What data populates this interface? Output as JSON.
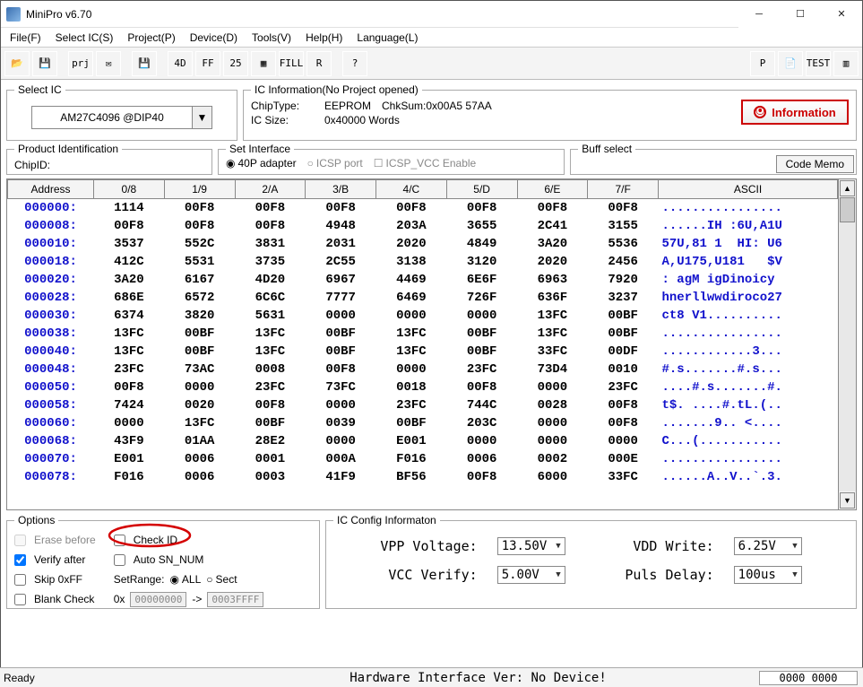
{
  "window": {
    "title": "MiniPro v6.70"
  },
  "menu": {
    "items": [
      "File(F)",
      "Select IC(S)",
      "Project(P)",
      "Device(D)",
      "Tools(V)",
      "Help(H)",
      "Language(L)"
    ]
  },
  "toolbar": {
    "buttons": [
      {
        "name": "open-icon",
        "label": "📂"
      },
      {
        "name": "save-icon",
        "label": "💾"
      },
      {
        "name": "open-project-icon",
        "label": "prj"
      },
      {
        "name": "save-project-icon",
        "label": "✉"
      },
      {
        "name": "disk-icon",
        "label": "💾"
      },
      {
        "name": "search-4d-icon",
        "label": "4D"
      },
      {
        "name": "ff-icon",
        "label": "FF"
      },
      {
        "name": "25-icon",
        "label": "25"
      },
      {
        "name": "box-icon",
        "label": "▦"
      },
      {
        "name": "fill-icon",
        "label": "FILL"
      },
      {
        "name": "r-icon",
        "label": "R"
      },
      {
        "name": "help-icon",
        "label": "?"
      },
      {
        "name": "p-chip-icon",
        "label": "P"
      },
      {
        "name": "sheet-icon",
        "label": "📄"
      },
      {
        "name": "test-icon",
        "label": "TEST"
      },
      {
        "name": "chip-icon",
        "label": "▥"
      }
    ]
  },
  "select_ic": {
    "legend": "Select IC",
    "value": "AM27C4096  @DIP40"
  },
  "ic_info": {
    "legend": "IC Information(No Project opened)",
    "chip_type_label": "ChipType:",
    "chip_type": "EEPROM",
    "chk_sum_label": "ChkSum:0x00A5 57AA",
    "ic_size_label": "IC Size:",
    "ic_size": "0x40000 Words",
    "info_button": "Information"
  },
  "product_id": {
    "legend": "Product Identification",
    "chipid_label": "ChipID:"
  },
  "set_interface": {
    "legend": "Set Interface",
    "option_40p": "40P adapter",
    "option_icsp": "ICSP port",
    "chk_icsp_vcc": "ICSP_VCC Enable"
  },
  "buff_select": {
    "legend": "Buff select",
    "code_memo": "Code Memo"
  },
  "hex": {
    "headers": [
      "Address",
      "0/8",
      "1/9",
      "2/A",
      "3/B",
      "4/C",
      "5/D",
      "6/E",
      "7/F",
      "ASCII"
    ],
    "rows": [
      {
        "addr": "000000:",
        "d": [
          "1114",
          "00F8",
          "00F8",
          "00F8",
          "00F8",
          "00F8",
          "00F8",
          "00F8"
        ],
        "ascii": "................"
      },
      {
        "addr": "000008:",
        "d": [
          "00F8",
          "00F8",
          "00F8",
          "4948",
          "203A",
          "3655",
          "2C41",
          "3155"
        ],
        "ascii": "......IH :6U,A1U"
      },
      {
        "addr": "000010:",
        "d": [
          "3537",
          "552C",
          "3831",
          "2031",
          "2020",
          "4849",
          "3A20",
          "5536"
        ],
        "ascii": "57U,81 1  HI: U6"
      },
      {
        "addr": "000018:",
        "d": [
          "412C",
          "5531",
          "3735",
          "2C55",
          "3138",
          "3120",
          "2020",
          "2456"
        ],
        "ascii": "A,U175,U181   $V"
      },
      {
        "addr": "000020:",
        "d": [
          "3A20",
          "6167",
          "4D20",
          "6967",
          "4469",
          "6E6F",
          "6963",
          "7920"
        ],
        "ascii": ": agM igDinoicy "
      },
      {
        "addr": "000028:",
        "d": [
          "686E",
          "6572",
          "6C6C",
          "7777",
          "6469",
          "726F",
          "636F",
          "3237"
        ],
        "ascii": "hnerllwwdiroco27"
      },
      {
        "addr": "000030:",
        "d": [
          "6374",
          "3820",
          "5631",
          "0000",
          "0000",
          "0000",
          "13FC",
          "00BF"
        ],
        "ascii": "ct8 V1.........."
      },
      {
        "addr": "000038:",
        "d": [
          "13FC",
          "00BF",
          "13FC",
          "00BF",
          "13FC",
          "00BF",
          "13FC",
          "00BF"
        ],
        "ascii": "................"
      },
      {
        "addr": "000040:",
        "d": [
          "13FC",
          "00BF",
          "13FC",
          "00BF",
          "13FC",
          "00BF",
          "33FC",
          "00DF"
        ],
        "ascii": "............3..."
      },
      {
        "addr": "000048:",
        "d": [
          "23FC",
          "73AC",
          "0008",
          "00F8",
          "0000",
          "23FC",
          "73D4",
          "0010"
        ],
        "ascii": "#.s.......#.s..."
      },
      {
        "addr": "000050:",
        "d": [
          "00F8",
          "0000",
          "23FC",
          "73FC",
          "0018",
          "00F8",
          "0000",
          "23FC"
        ],
        "ascii": "....#.s.......#."
      },
      {
        "addr": "000058:",
        "d": [
          "7424",
          "0020",
          "00F8",
          "0000",
          "23FC",
          "744C",
          "0028",
          "00F8"
        ],
        "ascii": "t$. ....#.tL.(.."
      },
      {
        "addr": "000060:",
        "d": [
          "0000",
          "13FC",
          "00BF",
          "0039",
          "00BF",
          "203C",
          "0000",
          "00F8"
        ],
        "ascii": ".......9.. <...."
      },
      {
        "addr": "000068:",
        "d": [
          "43F9",
          "01AA",
          "28E2",
          "0000",
          "E001",
          "0000",
          "0000",
          "0000"
        ],
        "ascii": "C...(..........."
      },
      {
        "addr": "000070:",
        "d": [
          "E001",
          "0006",
          "0001",
          "000A",
          "F016",
          "0006",
          "0002",
          "000E"
        ],
        "ascii": "................"
      },
      {
        "addr": "000078:",
        "d": [
          "F016",
          "0006",
          "0003",
          "41F9",
          "BF56",
          "00F8",
          "6000",
          "33FC"
        ],
        "ascii": "......A..V..`.3."
      }
    ]
  },
  "options": {
    "legend": "Options",
    "erase_before": "Erase before",
    "verify_after": "Verify after",
    "skip_0xff": "Skip 0xFF",
    "blank_check": "Blank Check",
    "check_id": "Check ID",
    "auto_sn": "Auto SN_NUM",
    "setrange": "SetRange:",
    "all": "ALL",
    "sect": "Sect",
    "0x": "0x",
    "from": "00000000",
    "arrow": "->",
    "to": "0003FFFF"
  },
  "ic_config": {
    "legend": "IC Config Informaton",
    "vpp_label": "VPP Voltage:",
    "vpp_value": "13.50V",
    "vdd_label": "VDD Write:",
    "vdd_value": "6.25V",
    "vcc_label": "VCC Verify:",
    "vcc_value": "5.00V",
    "puls_label": "Puls Delay:",
    "puls_value": "100us"
  },
  "status": {
    "left": "Ready",
    "center": "Hardware Interface Ver: No Device!",
    "right": "0000 0000"
  }
}
